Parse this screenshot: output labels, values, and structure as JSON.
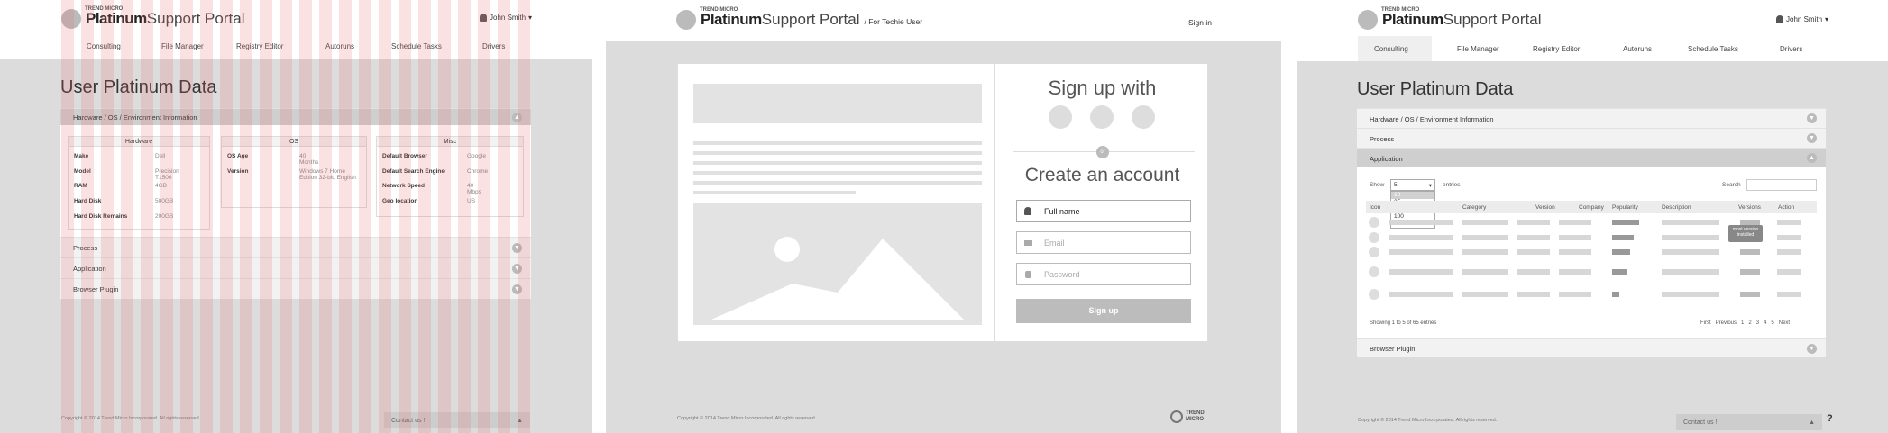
{
  "brand": {
    "small": "TREND MICRO",
    "bold": "Platinum",
    "light": "Support Portal",
    "subtitle": "/ For Techie User"
  },
  "user": {
    "name": "John Smith",
    "caret": "▾"
  },
  "nav": [
    "Consulting",
    "File Manager",
    "Registry Editor",
    "Autoruns",
    "Schedule Tasks",
    "Drivers"
  ],
  "page_title": "User Platinum Data",
  "sections": {
    "hardware": "Hardware / OS / Environment Information",
    "process": "Process",
    "application": "Application",
    "browser": "Browser Plugin"
  },
  "boxes": {
    "hardware": {
      "title": "Hardware",
      "rows": [
        [
          "Make",
          "Dell"
        ],
        [
          "Model",
          "Precision T1500"
        ],
        [
          "RAM",
          "4GB"
        ],
        [
          "Hard Disk",
          "500GB"
        ],
        [
          "Hard Disk Remains",
          "200GB"
        ]
      ]
    },
    "os": {
      "title": "OS",
      "rows": [
        [
          "OS Age",
          "40 Months"
        ],
        [
          "Version",
          "Windows 7 Home Edition 32-bit, English"
        ]
      ]
    },
    "misc": {
      "title": "Misc",
      "rows": [
        [
          "Default Browser",
          "Google"
        ],
        [
          "Default Search Engine",
          "Chrome"
        ],
        [
          "Network Speed",
          "40 Mbps"
        ],
        [
          "Geo location",
          "US"
        ]
      ]
    }
  },
  "footer": "Copyright © 2014 Trend Micro Incorporated. All rights reserved.",
  "contact": "Contact us !",
  "signin": "Sign in",
  "signup": {
    "heading": "Sign up with",
    "or": "or",
    "create": "Create an account",
    "fullname": "Full name",
    "email": "Email",
    "password": "Password",
    "button": "Sign up"
  },
  "trend_logo": "TREND MICRO",
  "table": {
    "show": "Show",
    "show_value": "5",
    "entries": "entries",
    "search": "Search",
    "options": [
      "5",
      "10",
      "25",
      "50",
      "100"
    ],
    "headers": [
      "Icon",
      "Category",
      "Version",
      "Company",
      "Popularity",
      "Description",
      "Versions",
      "Action"
    ],
    "tooltip": "most version installed",
    "showing": "Showing 1 to 5 of 65 entries",
    "pager": [
      "First",
      "Previous",
      "1",
      "2",
      "3",
      "4",
      "5",
      "Next"
    ]
  },
  "help_glyph": "?",
  "colors": {
    "stripe": "#e96e6e",
    "panel_bg": "#dcdcdc",
    "accent_button": "#c2c2c2"
  }
}
